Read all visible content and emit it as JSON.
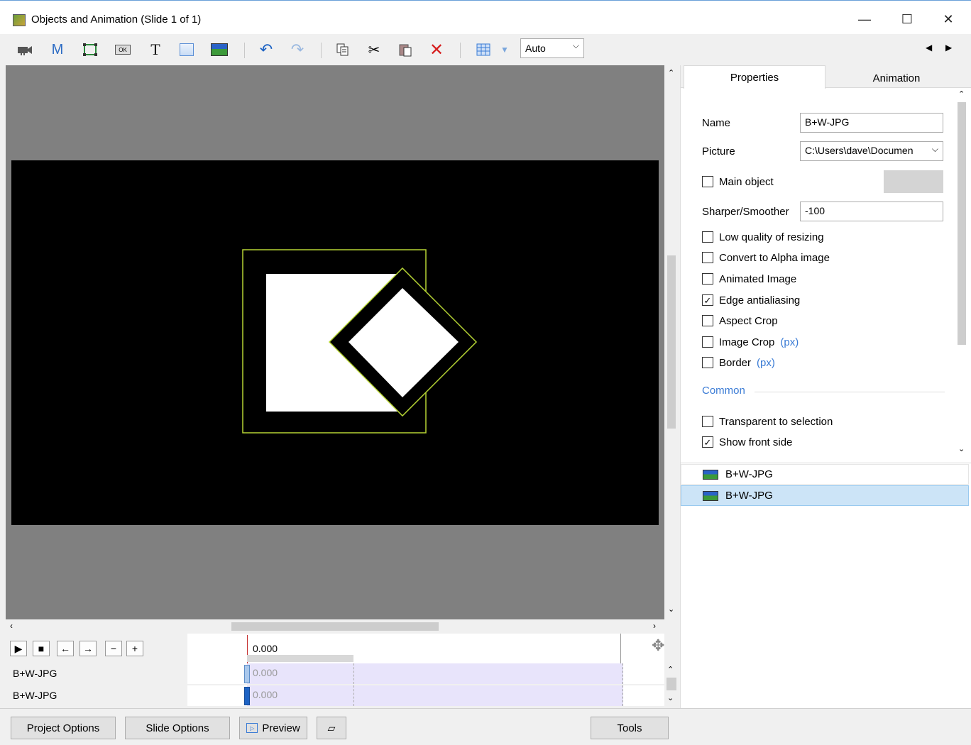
{
  "window": {
    "title": "Objects and Animation (Slide 1 of 1)",
    "minimize_glyph": "—",
    "maximize_glyph": "☐",
    "close_glyph": "✕"
  },
  "toolbar": {
    "zoom_value": "Auto",
    "icons": [
      "camera-icon",
      "mask-icon",
      "frame-icon",
      "button-icon",
      "text-icon",
      "rectangle-icon",
      "image-icon",
      "undo-icon",
      "redo-icon",
      "copy-icon",
      "cut-icon",
      "paste-icon",
      "delete-icon",
      "grid-icon"
    ],
    "m_glyph": "M",
    "t_glyph": "T",
    "ok_glyph": "OK"
  },
  "tabs": {
    "properties": "Properties",
    "animation": "Animation"
  },
  "properties": {
    "name_label": "Name",
    "name_value": "B+W-JPG",
    "picture_label": "Picture",
    "picture_value": "C:\\Users\\dave\\Documen",
    "main_object_label": "Main object",
    "sharper_label": "Sharper/Smoother",
    "sharper_value": "-100",
    "checkboxes": [
      {
        "label": "Low quality of resizing",
        "checked": false
      },
      {
        "label": "Convert to Alpha image",
        "checked": false
      },
      {
        "label": "Animated Image",
        "checked": false
      },
      {
        "label": "Edge antialiasing",
        "checked": true
      },
      {
        "label": "Aspect Crop",
        "checked": false
      },
      {
        "label": "Image Crop",
        "checked": false,
        "suffix": "(px)"
      },
      {
        "label": "Border",
        "checked": false,
        "suffix": "(px)"
      }
    ],
    "common_label": "Common",
    "common_checkboxes": [
      {
        "label": "Transparent to selection",
        "checked": false
      },
      {
        "label": "Show front side",
        "checked": true
      }
    ]
  },
  "objects": [
    {
      "name": "B+W-JPG",
      "selected": false
    },
    {
      "name": "B+W-JPG",
      "selected": true
    }
  ],
  "timeline": {
    "current_time": "0.000",
    "rows": [
      {
        "label": "B+W-JPG",
        "time": "0.000"
      },
      {
        "label": "B+W-JPG",
        "time": "0.000"
      }
    ]
  },
  "bottom": {
    "project_options": "Project Options",
    "slide_options": "Slide Options",
    "preview": "Preview",
    "tools": "Tools"
  },
  "colors": {
    "accent": "#3a7bd5",
    "selection_frame": "#b5d334",
    "selected_row": "#cce4f7",
    "timeline_bar": "#e8e4fb"
  }
}
